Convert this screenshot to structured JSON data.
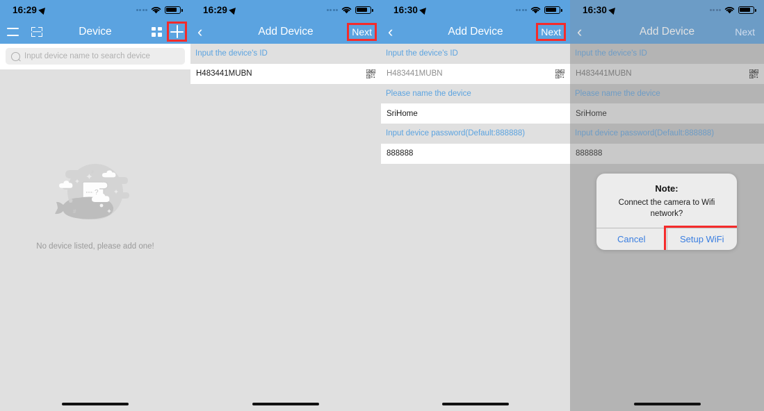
{
  "panels": [
    {
      "id": "device-list",
      "status": {
        "time": "16:29",
        "location_icon": "location-arrow-icon",
        "wifi_icon": "wifi-icon",
        "battery_icon": "battery-icon"
      },
      "nav": {
        "title": "Device",
        "menu_icon": "hamburger-menu-icon",
        "scan_icon": "scan-frame-icon",
        "grid_icon": "grid-view-icon",
        "add_icon": "plus-icon"
      },
      "search": {
        "placeholder": "Input device name to search device",
        "icon": "search-icon",
        "value": ""
      },
      "empty": {
        "message": "No device listed, please add one!",
        "illustration": "no-device-illustration"
      },
      "highlight": "add-device-button"
    },
    {
      "id": "add-device-step1",
      "status": {
        "time": "16:29",
        "location_icon": "location-arrow-icon",
        "wifi_icon": "wifi-icon",
        "battery_icon": "battery-icon"
      },
      "nav": {
        "title": "Add Device",
        "back_icon": "chevron-left-icon",
        "next_label": "Next"
      },
      "fields": [
        {
          "label": "Input the device's ID",
          "value": "H483441MUBN",
          "muted": false,
          "qr_icon": "qr-code-icon"
        }
      ],
      "highlight": "next-button"
    },
    {
      "id": "add-device-step2",
      "status": {
        "time": "16:30",
        "location_icon": "location-arrow-icon",
        "wifi_icon": "wifi-icon",
        "battery_icon": "battery-icon"
      },
      "nav": {
        "title": "Add Device",
        "back_icon": "chevron-left-icon",
        "next_label": "Next"
      },
      "fields": [
        {
          "label": "Input the device's ID",
          "value": "H483441MUBN",
          "muted": true,
          "qr_icon": "qr-code-icon"
        },
        {
          "label": "Please name the device",
          "value": "SriHome",
          "muted": false,
          "qr_icon": ""
        },
        {
          "label": "Input device password(Default:888888)",
          "value": "888888",
          "muted": false,
          "qr_icon": ""
        }
      ],
      "highlight": "next-button"
    },
    {
      "id": "add-device-wifi-prompt",
      "status": {
        "time": "16:30",
        "location_icon": "location-arrow-icon",
        "wifi_icon": "wifi-icon",
        "battery_icon": "battery-icon"
      },
      "nav": {
        "title": "Add Device",
        "back_icon": "chevron-left-icon",
        "next_label": "Next"
      },
      "fields": [
        {
          "label": "Input the device's ID",
          "value": "H483441MUBN",
          "muted": true,
          "qr_icon": "qr-code-icon"
        },
        {
          "label": "Please name the device",
          "value": "SriHome",
          "muted": false,
          "qr_icon": ""
        },
        {
          "label": "Input device password(Default:888888)",
          "value": "888888",
          "muted": false,
          "qr_icon": ""
        }
      ],
      "dialog": {
        "title": "Note:",
        "message": "Connect the camera to Wifi network?",
        "cancel_label": "Cancel",
        "confirm_label": "Setup WiFi"
      },
      "highlight": "setup-wifi-button"
    }
  ],
  "colors": {
    "nav_blue": "#5ba3e0",
    "label_blue": "#5ba3e0",
    "highlight_red": "#f52b2b",
    "dialog_action_blue": "#3a7ee0",
    "page_gray": "#e0e0e0",
    "dimmed_gray": "#b4b4b4"
  }
}
